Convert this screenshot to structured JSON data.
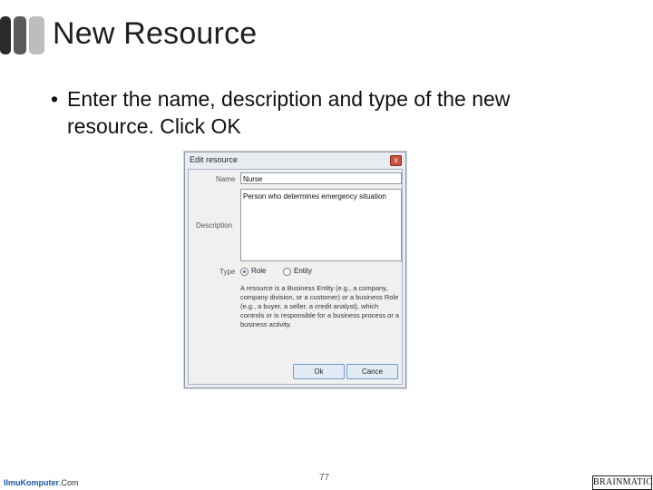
{
  "slide": {
    "title": "New Resource",
    "bullet_symbol": "•",
    "bullet": "Enter the name, description and type of the new resource. Click OK"
  },
  "dialog": {
    "title": "Edit resource",
    "close_glyph": "x",
    "name_label": "Name",
    "name_value": "Nurse",
    "description_label": "Description",
    "description_value": "Person who determines emergency situation",
    "type_label": "Type",
    "type_options": [
      "Role",
      "Entity"
    ],
    "type_selected": "Role",
    "help_text": "A resource is a Business Entity (e.g., a company, company division, or a customer) or a business Role (e.g., a buyer, a seller, a credit analyst), which controls or is responsible for a business process or a business activity.",
    "ok_label": "Ok",
    "cancel_label": "Cance"
  },
  "footer": {
    "logo_main": "IlmuKomputer",
    "logo_domain": ".Com",
    "page_number": "77",
    "brand": "BRAINMATICS"
  },
  "colors": {
    "accent_radio": "#2a6bbf",
    "button_border": "#6f9bc8",
    "logo_blue": "#1c5aa8"
  }
}
